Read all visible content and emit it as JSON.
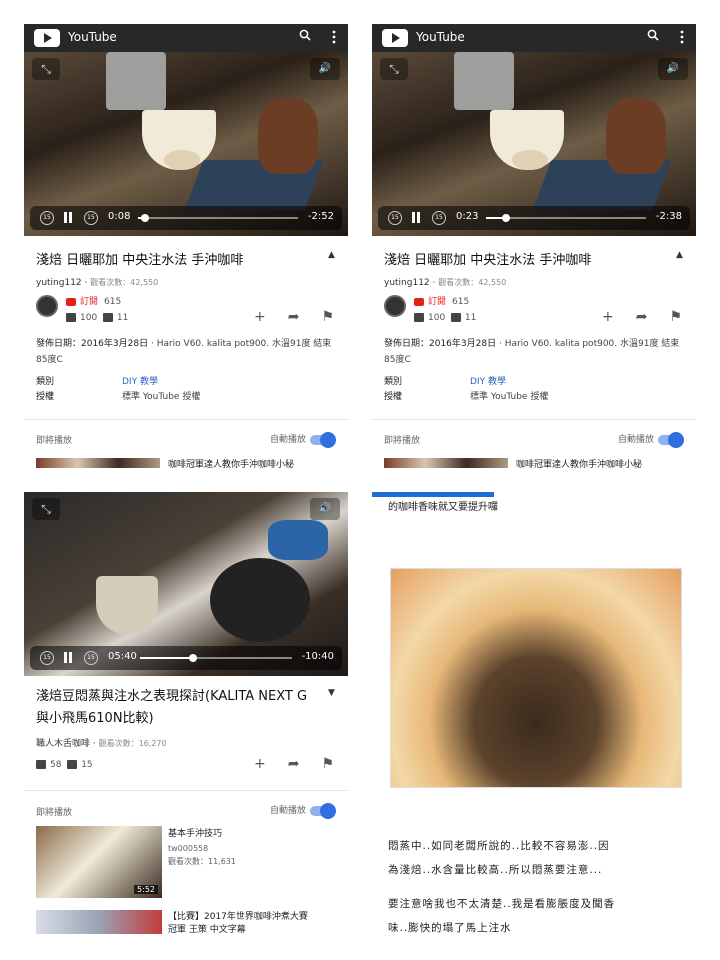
{
  "app": {
    "name": "YouTube"
  },
  "colors": {
    "youtube_red": "#e62117",
    "link_blue": "#2965c7",
    "toggle_blue": "#2f6fe0",
    "topbar": "#282828"
  },
  "panel1": {
    "time_current": "0:08",
    "time_remaining": "-2:52",
    "progress": 0.044,
    "title": "淺焙 日曬耶加 中央注水法 手沖咖啡",
    "channel": "yuting112",
    "views": "觀看次數：42,550",
    "subscribe_label": "訂閱",
    "subscriber_count": "615",
    "likes": "100",
    "dislikes": "11",
    "publish_label": "發佈日期：2016年3月28日",
    "description": "Hario V60. kalita pot900. 水溫91度 結束85度C",
    "category_label": "類別",
    "category_value": "DIY 教學",
    "license_label": "授權",
    "license_value": "標準 YouTube 授權",
    "up_next": "即將播放",
    "autoplay": "自動播放",
    "next_title": "咖啡冠軍達人教你手沖咖啡小秘"
  },
  "panel2": {
    "time_current": "0:23",
    "time_remaining": "-2:38",
    "progress": 0.128,
    "title": "淺焙 日曬耶加 中央注水法 手沖咖啡",
    "channel": "yuting112",
    "views": "觀看次數：42,550",
    "subscribe_label": "訂閱",
    "subscriber_count": "615",
    "likes": "100",
    "dislikes": "11",
    "publish_label": "發佈日期：2016年3月28日",
    "description": "Hario V60. kalita pot900. 水溫91度 結束85度C",
    "category_label": "類別",
    "category_value": "DIY 教學",
    "license_label": "授權",
    "license_value": "標準 YouTube 授權",
    "up_next": "即將播放",
    "autoplay": "自動播放",
    "next_title": "咖啡冠軍達人教你手沖咖啡小秘"
  },
  "panel3": {
    "time_current": "05:40",
    "time_remaining": "-10:40",
    "progress": 0.347,
    "title": "淺焙豆悶蒸與注水之表現探討(KALITA NEXT G 與小飛馬610N比較)",
    "title_line1": "淺焙豆悶蒸與注水之表現探討(KALITA NEXT G",
    "title_line2": "與小飛馬610N比較)",
    "channel": "職人木舌咖啡",
    "views": "觀看次數：16,270",
    "likes": "58",
    "dislikes": "15",
    "up_next": "即將播放",
    "autoplay": "自動播放",
    "related": [
      {
        "title": "基本手沖技巧",
        "channel": "tw000558",
        "views": "觀看次數：11,631",
        "duration": "5:52"
      },
      {
        "title_line1": "【比賽】2017年世界咖啡沖煮大賽",
        "title_line2": "冠軍 王策 中文字幕"
      }
    ]
  },
  "panel4": {
    "header_text": "的咖啡香味就又要提升囉",
    "paragraph1_line1": "悶蒸中..如同老闆所說的..比較不容易澎..因",
    "paragraph1_line2": "為淺焙..水含量比較高..所以悶蒸要注意...",
    "paragraph2_line1": "要注意啥我也不太清楚..我是看膨脹度及聞香",
    "paragraph2_line2": "味..膨快的塌了馬上注水"
  }
}
